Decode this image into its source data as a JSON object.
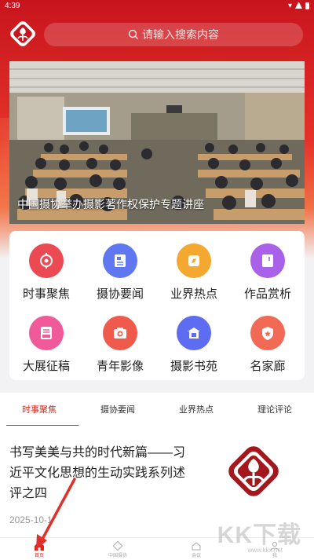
{
  "status_bar": {
    "time": "4:39"
  },
  "header": {
    "search_placeholder": "请输入搜索内容"
  },
  "banner": {
    "caption": "中国摄协举办摄影著作权保护专题讲座",
    "dot_count": 3,
    "active_dot": 1
  },
  "grid": [
    {
      "label": "时事聚焦",
      "icon": "target-icon",
      "color": "#ec4a53"
    },
    {
      "label": "摄协要闻",
      "icon": "news-icon",
      "color": "#6077f2"
    },
    {
      "label": "业界热点",
      "icon": "compass-icon",
      "color": "#f5a830"
    },
    {
      "label": "作品赏析",
      "icon": "frame-icon",
      "color": "#a861e8"
    },
    {
      "label": "大展征稿",
      "icon": "inbox-icon",
      "color": "#f15a9a"
    },
    {
      "label": "青年影像",
      "icon": "camera-icon",
      "color": "#f05a4c"
    },
    {
      "label": "摄影书苑",
      "icon": "library-icon",
      "color": "#5d6cf0"
    },
    {
      "label": "名家廊",
      "icon": "badge-icon",
      "color": "#f26a55"
    }
  ],
  "tabs": [
    {
      "label": "时事聚焦",
      "active": true
    },
    {
      "label": "摄协要闻",
      "active": false
    },
    {
      "label": "业界热点",
      "active": false
    },
    {
      "label": "理论评论",
      "active": false
    }
  ],
  "article": {
    "title": "书写美美与共的时代新篇——习近平文化思想的生动实践系列述评之四",
    "date": "2025-10-1"
  },
  "bottom_nav": [
    {
      "label": "首页",
      "icon": "home-icon",
      "active": true
    },
    {
      "label": "中国摄协",
      "icon": "diamond-icon",
      "active": false
    },
    {
      "label": "会议",
      "icon": "house-icon",
      "active": false
    },
    {
      "label": "我",
      "icon": "user-icon",
      "active": false
    }
  ],
  "watermark": {
    "brand": "KK下载",
    "url": "www.kkx.net"
  },
  "colors": {
    "primary": "#d8241d",
    "hero": "#e5332a"
  }
}
